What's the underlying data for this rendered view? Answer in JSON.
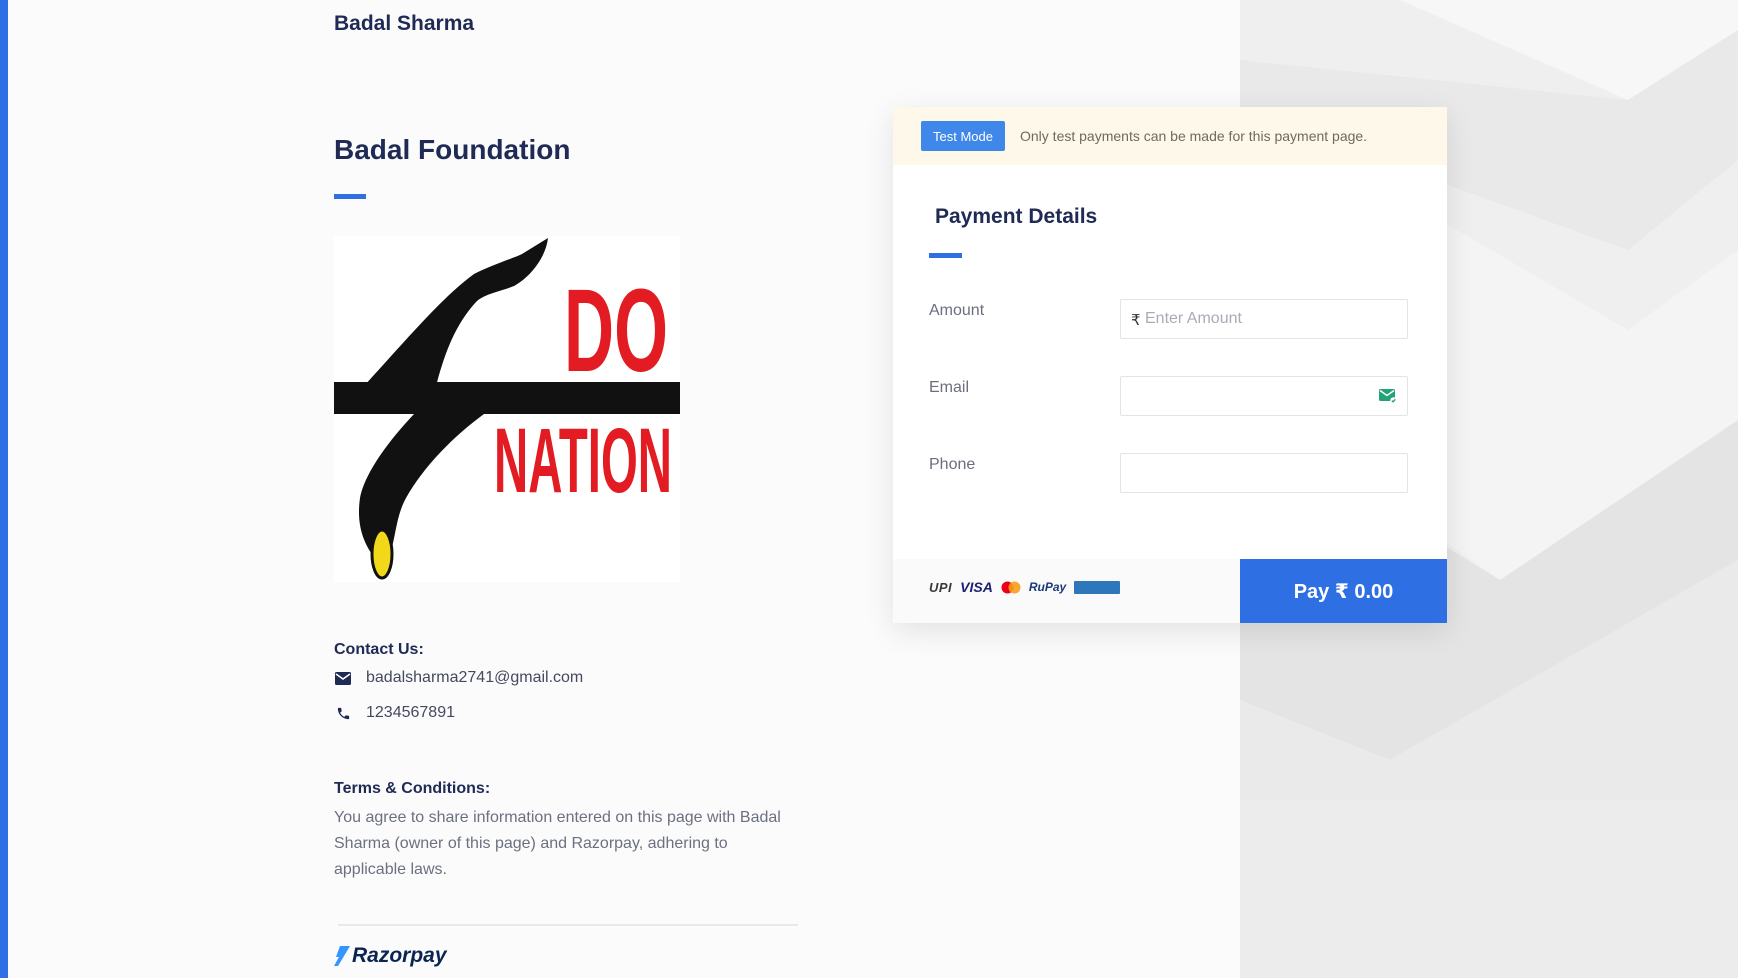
{
  "merchant": {
    "name": "Badal Sharma"
  },
  "page": {
    "title": "Badal Foundation",
    "logo_text": [
      "DO",
      "NATION"
    ]
  },
  "contact": {
    "heading": "Contact Us:",
    "email": "badalsharma2741@gmail.com",
    "phone": "1234567891"
  },
  "terms": {
    "heading": "Terms & Conditions:",
    "text": "You agree to share information entered on this page with Badal Sharma (owner of this page) and Razorpay, adhering to applicable laws."
  },
  "brand": {
    "name": "Razorpay"
  },
  "test_mode": {
    "badge": "Test Mode",
    "message": "Only test payments can be made for this payment page."
  },
  "payment": {
    "title": "Payment Details",
    "fields": {
      "amount": {
        "label": "Amount",
        "placeholder": "Enter Amount",
        "prefix": "₹",
        "value": ""
      },
      "email": {
        "label": "Email",
        "value": ""
      },
      "phone": {
        "label": "Phone",
        "value": ""
      }
    },
    "methods": [
      "UPI",
      "VISA",
      "Mastercard",
      "RuPay",
      "American Express"
    ],
    "pay_button": "Pay  ₹ 0.00"
  },
  "colors": {
    "accent": "#2f6fe4",
    "title": "#1f2a55",
    "test_banner_bg": "#fdf8ea",
    "logo_red": "#e31b23"
  }
}
